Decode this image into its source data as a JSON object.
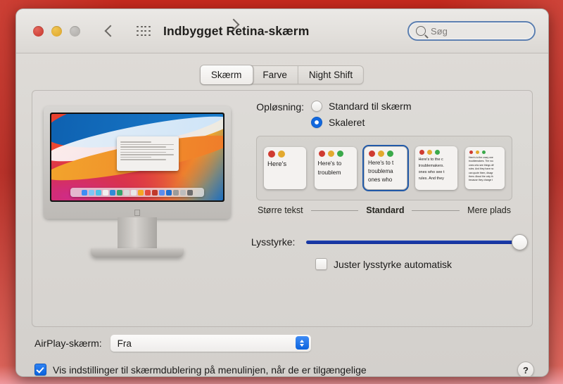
{
  "window": {
    "title": "Indbygget Retina-skærm",
    "traffic_lights": [
      "close",
      "minimize",
      "zoom"
    ],
    "back_label": "Tilbage",
    "forward_label": "Frem",
    "grid_label": "Vis alle"
  },
  "search": {
    "placeholder": "Søg",
    "value": ""
  },
  "tabs": [
    {
      "label": "Skærm",
      "selected": true
    },
    {
      "label": "Farve",
      "selected": false
    },
    {
      "label": "Night Shift",
      "selected": false
    }
  ],
  "resolution": {
    "label": "Opløsning:",
    "options": [
      {
        "label": "Standard til skærm",
        "selected": false
      },
      {
        "label": "Skaleret",
        "selected": true
      }
    ],
    "thumbnails": [
      {
        "index": 1,
        "dots": 2,
        "lines": [
          "Here's"
        ],
        "selected": false,
        "font_size": 9.5
      },
      {
        "index": 2,
        "dots": 3,
        "lines": [
          "Here's to",
          "troublem"
        ],
        "selected": false,
        "font_size": 8.5
      },
      {
        "index": 3,
        "dots": 3,
        "lines": [
          "Here's to t",
          "troublema",
          "ones who"
        ],
        "selected": true,
        "font_size": 8
      },
      {
        "index": 4,
        "dots": 3,
        "lines": [
          "Here's to the c",
          "troublemakers.",
          "ones who see t",
          "rules. And they"
        ],
        "selected": false,
        "font_size": 5.5
      },
      {
        "index": 5,
        "dots": 3,
        "lines": [
          "Here's to the crazy one",
          "troublemakers. The rou",
          "ones who see things dif",
          "rules. And they have no",
          "can quote them, disagr",
          "them. About the only th",
          "because they change t"
        ],
        "selected": false,
        "font_size": 3.4
      }
    ],
    "scale_left": "Større tekst",
    "scale_middle": "Standard",
    "scale_right": "Mere plads"
  },
  "brightness": {
    "label": "Lysstyrke:",
    "value_percent": 97,
    "auto_label": "Juster lysstyrke automatisk",
    "auto_checked": false
  },
  "airplay": {
    "label": "AirPlay-skærm:",
    "value": "Fra",
    "options": [
      "Fra"
    ]
  },
  "mirroring": {
    "label": "Vis indstillinger til skærmdublering på menulinjen, når de er tilgængelige",
    "checked": true
  },
  "help": {
    "label": "?"
  },
  "colors": {
    "accent_blue": "#0c63dd",
    "selection_ring": "#2159a8",
    "slider_fill": "#17359f",
    "window_bg": "#d8d5d1",
    "photo_surround": "#b51d16"
  },
  "dock_icons": [
    "#3f8cf5",
    "#7ec7f5",
    "#4cc2e8",
    "#f0f0f0",
    "#2f8bd8",
    "#36a36b",
    "#d8d8d8",
    "#e8e8e8",
    "#f5a623",
    "#e24a3f",
    "#c0392b",
    "#5b8def",
    "#1f6fd0",
    "#9b9b9b",
    "#bdbdbd",
    "#6d6d6d"
  ],
  "thumb_dot_colors": [
    "#cf3b31",
    "#e3a92e",
    "#3aa94a"
  ]
}
